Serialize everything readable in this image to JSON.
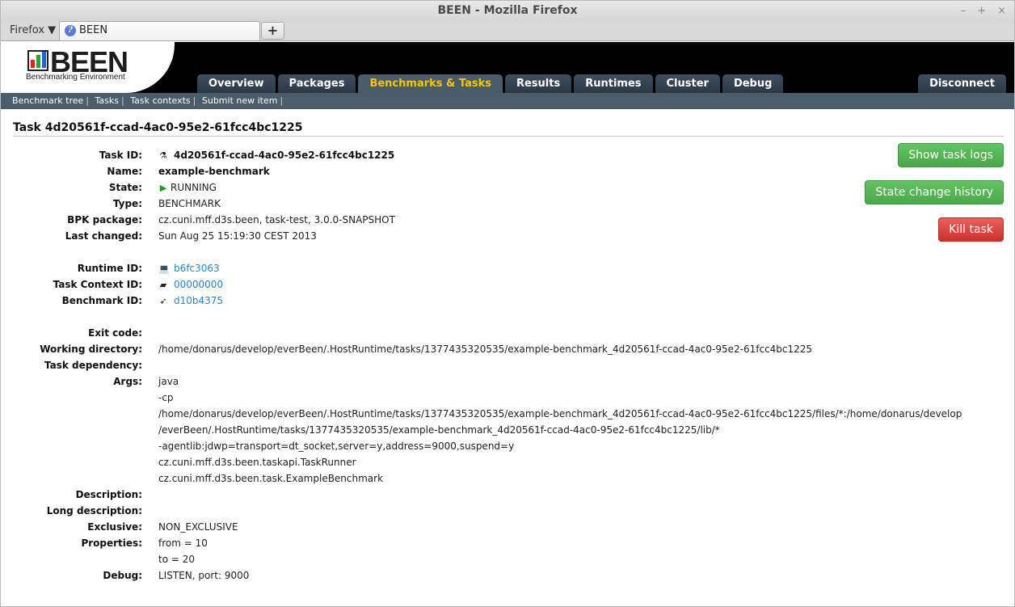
{
  "window": {
    "title": "BEEN - Mozilla Firefox",
    "controls": [
      "–",
      "+",
      "×"
    ]
  },
  "browser": {
    "menu_label": "Firefox ▼",
    "tab_label": "BEEN",
    "new_tab_label": "+"
  },
  "app": {
    "logo_text": "BEEN",
    "logo_subtitle": "Benchmarking Environment",
    "nav": [
      "Overview",
      "Packages",
      "Benchmarks & Tasks",
      "Results",
      "Runtimes",
      "Cluster",
      "Debug"
    ],
    "active_nav": "Benchmarks & Tasks",
    "disconnect_label": "Disconnect",
    "subnav": [
      "Benchmark tree",
      "Tasks",
      "Task contexts",
      "Submit new item"
    ]
  },
  "task": {
    "heading": "Task 4d20561f-ccad-4ac0-95e2-61fcc4bc1225",
    "labels": {
      "task_id": "Task ID:",
      "name": "Name:",
      "state": "State:",
      "type": "Type:",
      "bpk": "BPK package:",
      "last_changed": "Last changed:",
      "runtime_id": "Runtime ID:",
      "context_id": "Task Context ID:",
      "benchmark_id": "Benchmark ID:",
      "exit_code": "Exit code:",
      "working_dir": "Working directory:",
      "dependency": "Task dependency:",
      "args": "Args:",
      "description": "Description:",
      "long_description": "Long description:",
      "exclusive": "Exclusive:",
      "properties": "Properties:",
      "debug": "Debug:"
    },
    "task_id": "4d20561f-ccad-4ac0-95e2-61fcc4bc1225",
    "name": "example-benchmark",
    "state": "RUNNING",
    "type": "BENCHMARK",
    "bpk": "cz.cuni.mff.d3s.been, task-test, 3.0.0-SNAPSHOT",
    "last_changed": "Sun Aug 25 15:19:30 CEST 2013",
    "runtime_id": "b6fc3063",
    "context_id": "00000000",
    "benchmark_id": "d10b4375",
    "working_dir": "/home/donarus/develop/everBeen/.HostRuntime/tasks/1377435320535/example-benchmark_4d20561f-ccad-4ac0-95e2-61fcc4bc1225",
    "args": [
      "java",
      "-cp",
      "/home/donarus/develop/everBeen/.HostRuntime/tasks/1377435320535/example-benchmark_4d20561f-ccad-4ac0-95e2-61fcc4bc1225/files/*:/home/donarus/develop",
      "/everBeen/.HostRuntime/tasks/1377435320535/example-benchmark_4d20561f-ccad-4ac0-95e2-61fcc4bc1225/lib/*",
      "-agentlib:jdwp=transport=dt_socket,server=y,address=9000,suspend=y",
      "cz.cuni.mff.d3s.been.taskapi.TaskRunner",
      "cz.cuni.mff.d3s.been.task.ExampleBenchmark"
    ],
    "exclusive": "NON_EXCLUSIVE",
    "properties": [
      "from = 10",
      "to = 20"
    ],
    "debug": "LISTEN, port: 9000"
  },
  "buttons": {
    "show_logs": "Show task logs",
    "state_history": "State change history",
    "kill": "Kill task"
  },
  "icons": {
    "task_id": "flask-icon",
    "state": "play-icon",
    "runtime": "laptop-icon",
    "context": "book-icon",
    "benchmark": "rocket-icon"
  },
  "colors": {
    "header_bg": "#000000",
    "nav_active_text": "#f6c700",
    "subnav_bg": "#4b5d6b",
    "link": "#2a86c6",
    "green": "#4aa84a",
    "red": "#c9302c"
  }
}
